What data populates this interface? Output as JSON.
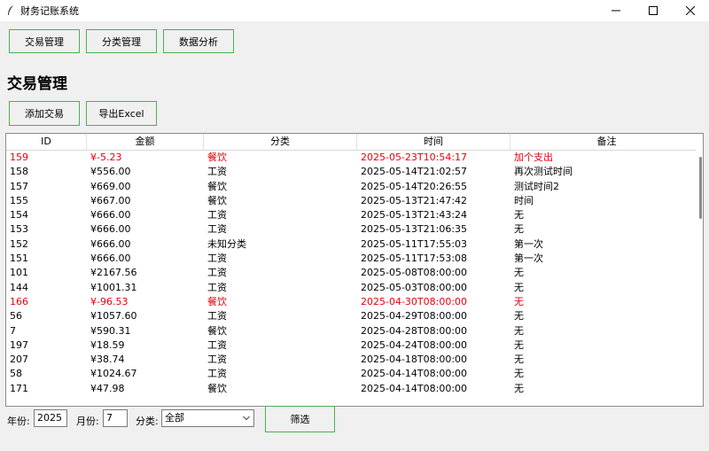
{
  "window": {
    "title": "财务记账系统"
  },
  "nav": {
    "transactions": "交易管理",
    "categories": "分类管理",
    "analysis": "数据分析"
  },
  "section_title": "交易管理",
  "actions": {
    "add": "添加交易",
    "export": "导出Excel"
  },
  "table": {
    "columns": [
      "ID",
      "金额",
      "分类",
      "时间",
      "备注"
    ],
    "rows": [
      {
        "id": "159",
        "amount": "¥-5.23",
        "category": "餐饮",
        "time": "2025-05-23T10:54:17",
        "note": "加个支出",
        "highlight": true
      },
      {
        "id": "158",
        "amount": "¥556.00",
        "category": "工资",
        "time": "2025-05-14T21:02:57",
        "note": "再次测试时间",
        "highlight": false
      },
      {
        "id": "157",
        "amount": "¥669.00",
        "category": "餐饮",
        "time": "2025-05-14T20:26:55",
        "note": "测试时间2",
        "highlight": false
      },
      {
        "id": "155",
        "amount": "¥667.00",
        "category": "餐饮",
        "time": "2025-05-13T21:47:42",
        "note": "时间",
        "highlight": false
      },
      {
        "id": "154",
        "amount": "¥666.00",
        "category": "工资",
        "time": "2025-05-13T21:43:24",
        "note": "无",
        "highlight": false
      },
      {
        "id": "153",
        "amount": "¥666.00",
        "category": "工资",
        "time": "2025-05-13T21:06:35",
        "note": "无",
        "highlight": false
      },
      {
        "id": "152",
        "amount": "¥666.00",
        "category": "未知分类",
        "time": "2025-05-11T17:55:03",
        "note": "第一次",
        "highlight": false
      },
      {
        "id": "151",
        "amount": "¥666.00",
        "category": "工资",
        "time": "2025-05-11T17:53:08",
        "note": "第一次",
        "highlight": false
      },
      {
        "id": "101",
        "amount": "¥2167.56",
        "category": "工资",
        "time": "2025-05-08T08:00:00",
        "note": "无",
        "highlight": false
      },
      {
        "id": "144",
        "amount": "¥1001.31",
        "category": "工资",
        "time": "2025-05-03T08:00:00",
        "note": "无",
        "highlight": false
      },
      {
        "id": "166",
        "amount": "¥-96.53",
        "category": "餐饮",
        "time": "2025-04-30T08:00:00",
        "note": "无",
        "highlight": true
      },
      {
        "id": "56",
        "amount": "¥1057.60",
        "category": "工资",
        "time": "2025-04-29T08:00:00",
        "note": "无",
        "highlight": false
      },
      {
        "id": "7",
        "amount": "¥590.31",
        "category": "餐饮",
        "time": "2025-04-28T08:00:00",
        "note": "无",
        "highlight": false
      },
      {
        "id": "197",
        "amount": "¥18.59",
        "category": "工资",
        "time": "2025-04-24T08:00:00",
        "note": "无",
        "highlight": false
      },
      {
        "id": "207",
        "amount": "¥38.74",
        "category": "工资",
        "time": "2025-04-18T08:00:00",
        "note": "无",
        "highlight": false
      },
      {
        "id": "58",
        "amount": "¥1024.67",
        "category": "工资",
        "time": "2025-04-14T08:00:00",
        "note": "无",
        "highlight": false
      },
      {
        "id": "171",
        "amount": "¥47.98",
        "category": "餐饮",
        "time": "2025-04-14T08:00:00",
        "note": "无",
        "highlight": false
      }
    ]
  },
  "filter": {
    "year_label": "年份:",
    "year_value": "2025",
    "month_label": "月份:",
    "month_value": "7",
    "category_label": "分类:",
    "category_value": "全部",
    "submit": "筛选"
  },
  "colors": {
    "accent_border": "#4caf50",
    "expense_red": "#e8000b"
  }
}
